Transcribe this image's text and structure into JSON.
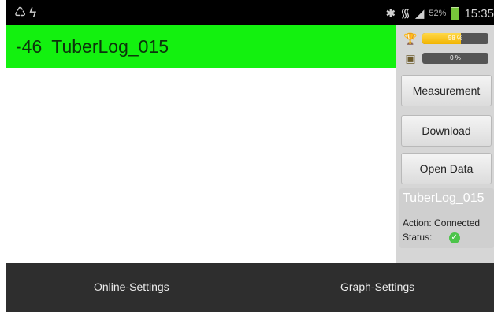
{
  "statusbar": {
    "left_icons": [
      "recycle-icon",
      "flash-icon"
    ],
    "bluetooth_icon": "bluetooth-icon",
    "wifi_icon": "wifi-icon",
    "signal_icon": "signal-icon",
    "battery_percent": "52%",
    "time": "15:35"
  },
  "header": {
    "rssi": "-46",
    "device_name": "TuberLog_015",
    "background_color": "#13f10f"
  },
  "meters": [
    {
      "icon": "trophy-icon",
      "label": "58 %",
      "fraction": 0.58,
      "color": "#f5c400"
    },
    {
      "icon": "storage-icon",
      "label": "0 %",
      "fraction": 0.0,
      "color": "#f5c400"
    }
  ],
  "buttons": {
    "measurement": "Measurement",
    "download": "Download",
    "open_data": "Open Data"
  },
  "info_panel": {
    "name": "TuberLog_015",
    "action_label": "Action:",
    "action_value": "Connected",
    "status_label": "Status:",
    "status_icon": "check-circle-icon"
  },
  "bottombar": {
    "online_settings": "Online-Settings",
    "graph_settings": "Graph-Settings"
  }
}
